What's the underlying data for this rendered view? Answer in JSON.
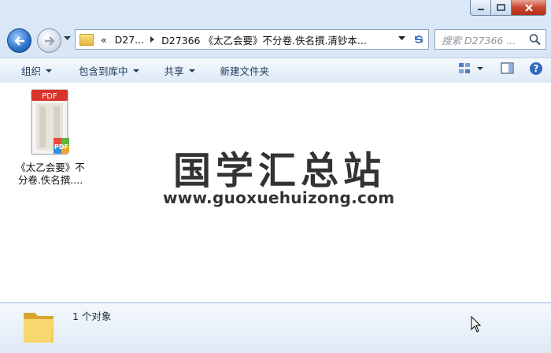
{
  "window": {
    "caption": {
      "minimize_icon": "minimize-icon",
      "maximize_icon": "maximize-icon",
      "close_icon": "close-icon"
    }
  },
  "nav": {
    "back_icon": "back-arrow-icon",
    "forward_icon": "forward-arrow-icon"
  },
  "address": {
    "overflow": "«",
    "segments": [
      "D27...",
      "D27366 《太乙会要》不分卷.佚名撰.清钞本..."
    ]
  },
  "search": {
    "placeholder": "搜索 D27366 ..."
  },
  "toolbar": {
    "organize": "组织",
    "include_in_library": "包含到库中",
    "share": "共享",
    "new_folder": "新建文件夹"
  },
  "files": [
    {
      "label": "《太乙会要》不分卷.佚名撰....",
      "icon": "pdf-file-icon",
      "badge": "PDF"
    }
  ],
  "watermark": {
    "title": "国学汇总站",
    "url": "www.guoxuehuizong.com"
  },
  "details": {
    "count_text": "1 个对象"
  },
  "colors": {
    "toolbar_text": "#1e395b",
    "pdf_red": "#d9342b",
    "close_button": "#c7472f"
  }
}
